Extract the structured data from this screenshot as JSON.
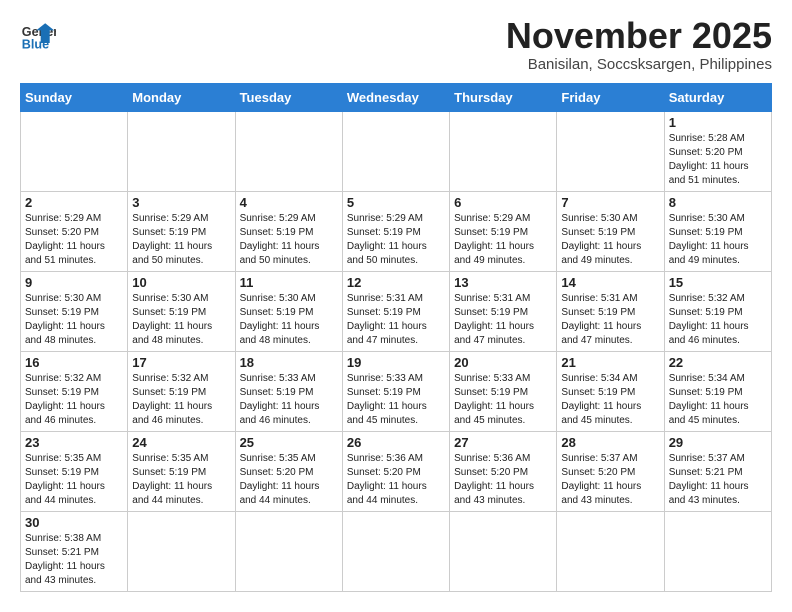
{
  "header": {
    "logo_general": "General",
    "logo_blue": "Blue",
    "month": "November 2025",
    "location": "Banisilan, Soccsksargen, Philippines"
  },
  "weekdays": [
    "Sunday",
    "Monday",
    "Tuesday",
    "Wednesday",
    "Thursday",
    "Friday",
    "Saturday"
  ],
  "weeks": [
    [
      {
        "day": "",
        "info": ""
      },
      {
        "day": "",
        "info": ""
      },
      {
        "day": "",
        "info": ""
      },
      {
        "day": "",
        "info": ""
      },
      {
        "day": "",
        "info": ""
      },
      {
        "day": "",
        "info": ""
      },
      {
        "day": "1",
        "info": "Sunrise: 5:28 AM\nSunset: 5:20 PM\nDaylight: 11 hours\nand 51 minutes."
      }
    ],
    [
      {
        "day": "2",
        "info": "Sunrise: 5:29 AM\nSunset: 5:20 PM\nDaylight: 11 hours\nand 51 minutes."
      },
      {
        "day": "3",
        "info": "Sunrise: 5:29 AM\nSunset: 5:19 PM\nDaylight: 11 hours\nand 50 minutes."
      },
      {
        "day": "4",
        "info": "Sunrise: 5:29 AM\nSunset: 5:19 PM\nDaylight: 11 hours\nand 50 minutes."
      },
      {
        "day": "5",
        "info": "Sunrise: 5:29 AM\nSunset: 5:19 PM\nDaylight: 11 hours\nand 50 minutes."
      },
      {
        "day": "6",
        "info": "Sunrise: 5:29 AM\nSunset: 5:19 PM\nDaylight: 11 hours\nand 49 minutes."
      },
      {
        "day": "7",
        "info": "Sunrise: 5:30 AM\nSunset: 5:19 PM\nDaylight: 11 hours\nand 49 minutes."
      },
      {
        "day": "8",
        "info": "Sunrise: 5:30 AM\nSunset: 5:19 PM\nDaylight: 11 hours\nand 49 minutes."
      }
    ],
    [
      {
        "day": "9",
        "info": "Sunrise: 5:30 AM\nSunset: 5:19 PM\nDaylight: 11 hours\nand 48 minutes."
      },
      {
        "day": "10",
        "info": "Sunrise: 5:30 AM\nSunset: 5:19 PM\nDaylight: 11 hours\nand 48 minutes."
      },
      {
        "day": "11",
        "info": "Sunrise: 5:30 AM\nSunset: 5:19 PM\nDaylight: 11 hours\nand 48 minutes."
      },
      {
        "day": "12",
        "info": "Sunrise: 5:31 AM\nSunset: 5:19 PM\nDaylight: 11 hours\nand 47 minutes."
      },
      {
        "day": "13",
        "info": "Sunrise: 5:31 AM\nSunset: 5:19 PM\nDaylight: 11 hours\nand 47 minutes."
      },
      {
        "day": "14",
        "info": "Sunrise: 5:31 AM\nSunset: 5:19 PM\nDaylight: 11 hours\nand 47 minutes."
      },
      {
        "day": "15",
        "info": "Sunrise: 5:32 AM\nSunset: 5:19 PM\nDaylight: 11 hours\nand 46 minutes."
      }
    ],
    [
      {
        "day": "16",
        "info": "Sunrise: 5:32 AM\nSunset: 5:19 PM\nDaylight: 11 hours\nand 46 minutes."
      },
      {
        "day": "17",
        "info": "Sunrise: 5:32 AM\nSunset: 5:19 PM\nDaylight: 11 hours\nand 46 minutes."
      },
      {
        "day": "18",
        "info": "Sunrise: 5:33 AM\nSunset: 5:19 PM\nDaylight: 11 hours\nand 46 minutes."
      },
      {
        "day": "19",
        "info": "Sunrise: 5:33 AM\nSunset: 5:19 PM\nDaylight: 11 hours\nand 45 minutes."
      },
      {
        "day": "20",
        "info": "Sunrise: 5:33 AM\nSunset: 5:19 PM\nDaylight: 11 hours\nand 45 minutes."
      },
      {
        "day": "21",
        "info": "Sunrise: 5:34 AM\nSunset: 5:19 PM\nDaylight: 11 hours\nand 45 minutes."
      },
      {
        "day": "22",
        "info": "Sunrise: 5:34 AM\nSunset: 5:19 PM\nDaylight: 11 hours\nand 45 minutes."
      }
    ],
    [
      {
        "day": "23",
        "info": "Sunrise: 5:35 AM\nSunset: 5:19 PM\nDaylight: 11 hours\nand 44 minutes."
      },
      {
        "day": "24",
        "info": "Sunrise: 5:35 AM\nSunset: 5:19 PM\nDaylight: 11 hours\nand 44 minutes."
      },
      {
        "day": "25",
        "info": "Sunrise: 5:35 AM\nSunset: 5:20 PM\nDaylight: 11 hours\nand 44 minutes."
      },
      {
        "day": "26",
        "info": "Sunrise: 5:36 AM\nSunset: 5:20 PM\nDaylight: 11 hours\nand 44 minutes."
      },
      {
        "day": "27",
        "info": "Sunrise: 5:36 AM\nSunset: 5:20 PM\nDaylight: 11 hours\nand 43 minutes."
      },
      {
        "day": "28",
        "info": "Sunrise: 5:37 AM\nSunset: 5:20 PM\nDaylight: 11 hours\nand 43 minutes."
      },
      {
        "day": "29",
        "info": "Sunrise: 5:37 AM\nSunset: 5:21 PM\nDaylight: 11 hours\nand 43 minutes."
      }
    ],
    [
      {
        "day": "30",
        "info": "Sunrise: 5:38 AM\nSunset: 5:21 PM\nDaylight: 11 hours\nand 43 minutes."
      },
      {
        "day": "",
        "info": ""
      },
      {
        "day": "",
        "info": ""
      },
      {
        "day": "",
        "info": ""
      },
      {
        "day": "",
        "info": ""
      },
      {
        "day": "",
        "info": ""
      },
      {
        "day": "",
        "info": ""
      }
    ]
  ]
}
